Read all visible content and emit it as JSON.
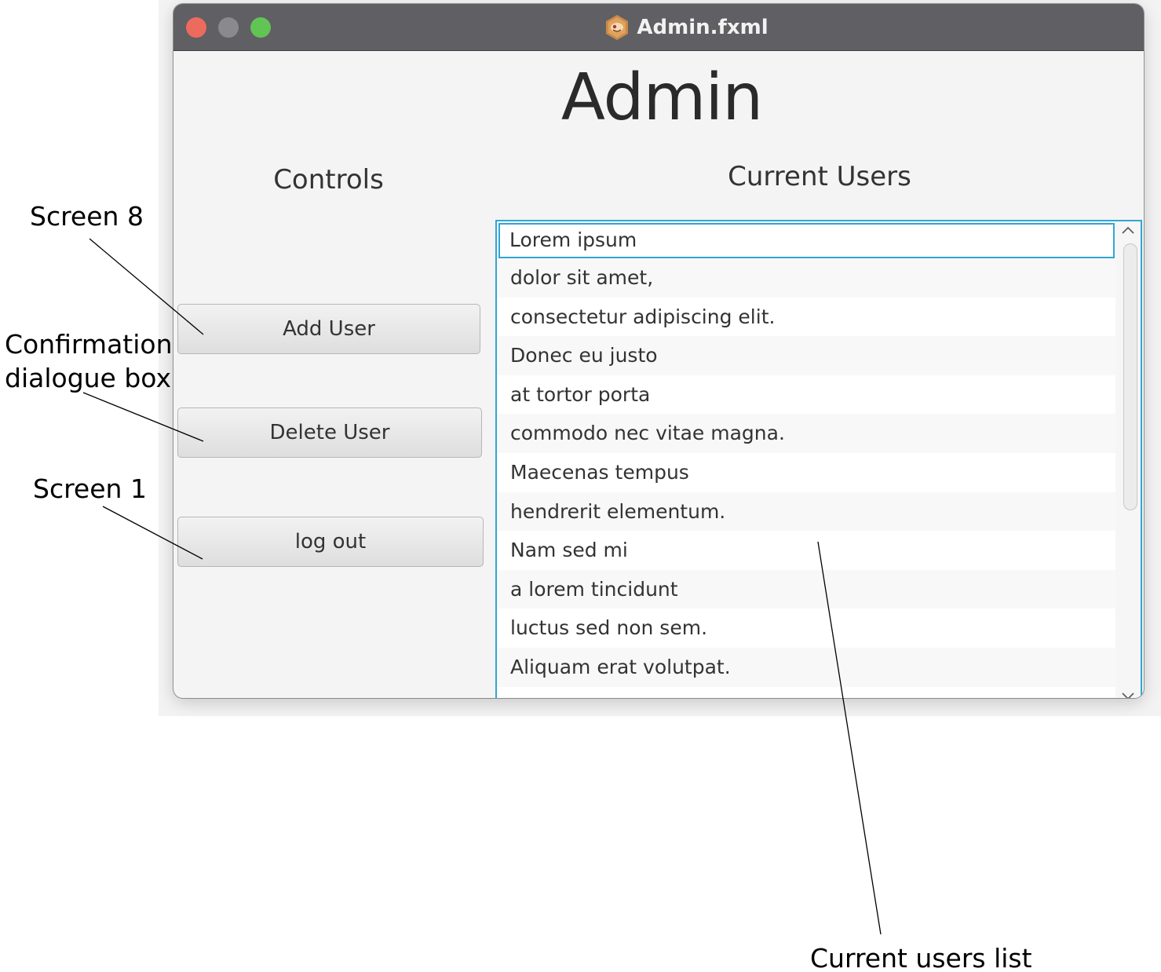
{
  "window": {
    "title": "Admin.fxml",
    "app_icon": "java-duke-icon"
  },
  "main": {
    "heading": "Admin",
    "controls_label": "Controls",
    "users_label": "Current Users"
  },
  "controls": {
    "add_user": "Add User",
    "delete_user": "Delete User",
    "log_out": "log out"
  },
  "users_list": {
    "items": [
      "Lorem ipsum",
      "dolor sit amet,",
      "consectetur adipiscing elit.",
      "Donec eu justo",
      "at tortor porta",
      "commodo nec vitae magna.",
      "Maecenas tempus",
      "hendrerit elementum.",
      "Nam sed mi",
      "a lorem tincidunt",
      "luctus sed non sem.",
      "Aliquam erat volutpat."
    ],
    "selected_index": 0
  },
  "annotations": {
    "screen8": "Screen 8",
    "confirmation_line1": "Confirmation",
    "confirmation_line2": "dialogue box",
    "screen1": "Screen 1",
    "current_users_list": "Current users list"
  },
  "colors": {
    "titlebar": "#605f63",
    "close": "#ed6a5e",
    "minimize": "#8a898c",
    "maximize": "#61c454",
    "focus_accent": "#2fa6d4"
  }
}
